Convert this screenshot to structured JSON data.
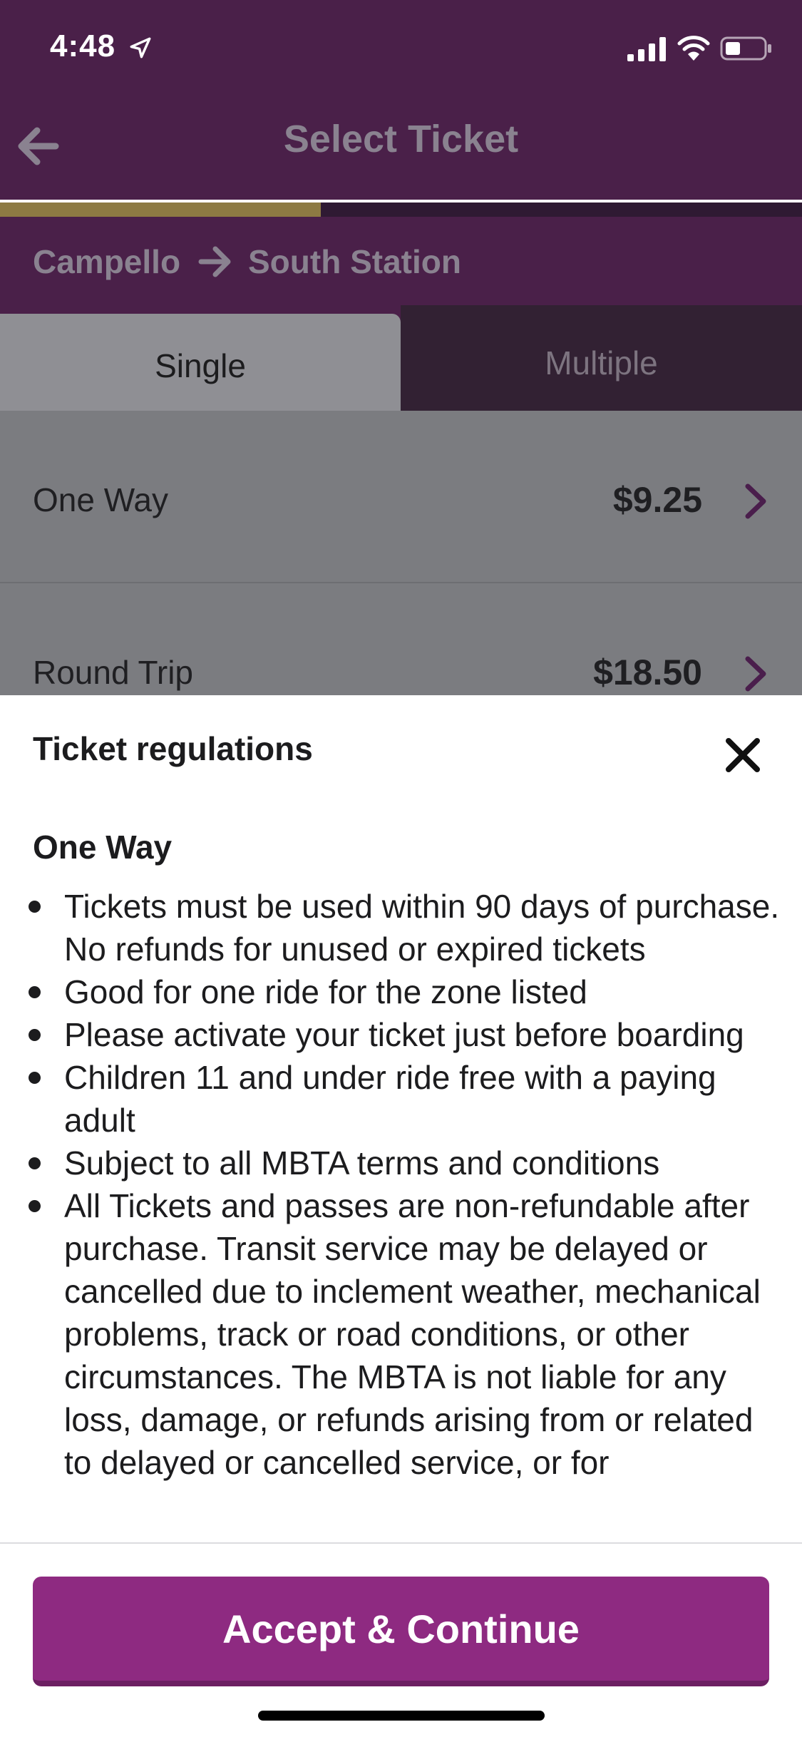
{
  "status_bar": {
    "time": "4:48"
  },
  "header": {
    "title": "Select Ticket",
    "progress_fraction": 0.4
  },
  "route": {
    "from": "Campello",
    "to": "South Station"
  },
  "tabs": [
    {
      "label": "Single",
      "selected": true
    },
    {
      "label": "Multiple",
      "selected": false
    }
  ],
  "tickets": [
    {
      "name": "One Way",
      "price": "$9.25"
    },
    {
      "name": "Round Trip",
      "price": "$18.50"
    }
  ],
  "sheet": {
    "title": "Ticket regulations",
    "section_heading": "One Way",
    "rules": [
      "Tickets must be used within 90 days of purchase. No refunds for unused or expired tickets",
      "Good for one ride for the zone listed",
      "Please activate your ticket just before boarding",
      "Children 11 and under ride free with a paying adult",
      "Subject to all MBTA terms and conditions",
      "All Tickets and passes are non-refundable after purchase. Transit service may be delayed or cancelled due to inclement weather, mechanical problems, track or road conditions, or other circumstances. The MBTA is not liable for any loss, damage, or refunds arising from or related to delayed or cancelled service, or for"
    ],
    "accept_label": "Accept & Continue"
  },
  "colors": {
    "header_purple": "#4a2049",
    "progress_gold": "#8d7a43",
    "accent_purple": "#8e2a81"
  }
}
